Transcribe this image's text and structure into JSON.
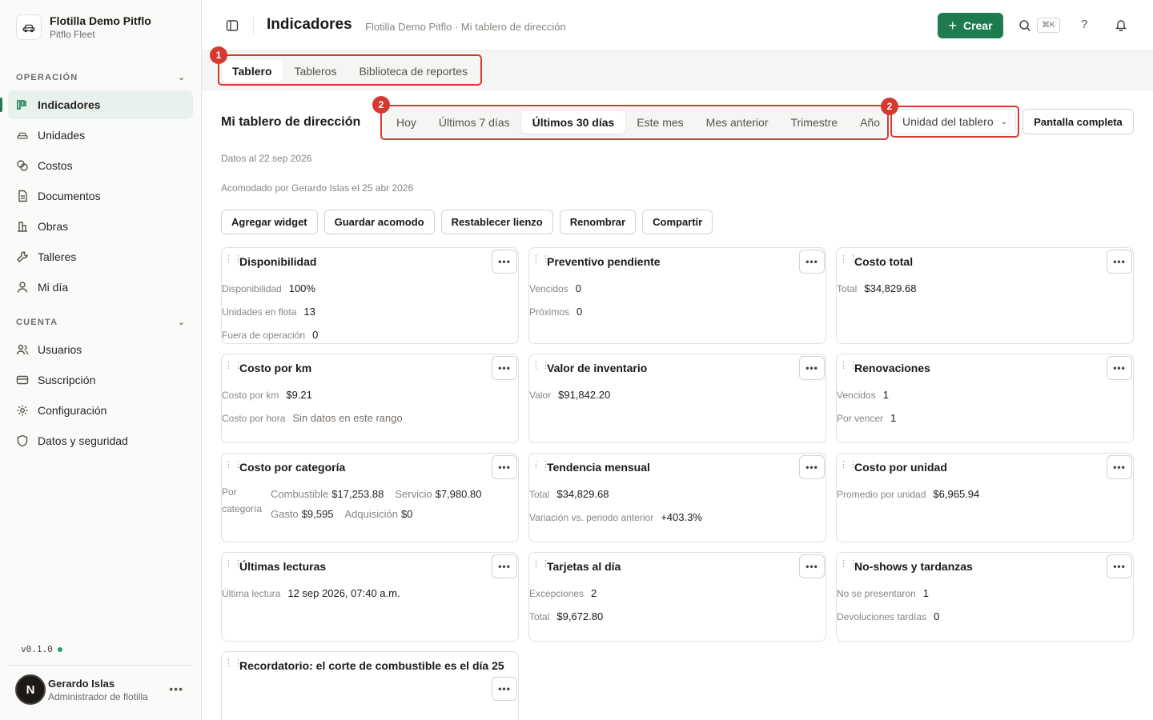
{
  "org": {
    "name": "Flotilla Demo Pitflo",
    "subtitle": "Pitflo Fleet"
  },
  "sidebar": {
    "section_operation": "OPERACIÓN",
    "section_account": "CUENTA",
    "operation_items": [
      {
        "label": "Indicadores",
        "icon": "chart-bars-icon",
        "active": true
      },
      {
        "label": "Unidades",
        "icon": "car-icon"
      },
      {
        "label": "Costos",
        "icon": "coins-icon"
      },
      {
        "label": "Documentos",
        "icon": "document-icon"
      },
      {
        "label": "Obras",
        "icon": "building-icon"
      },
      {
        "label": "Talleres",
        "icon": "wrench-icon"
      },
      {
        "label": "Mi día",
        "icon": "person-icon"
      }
    ],
    "account_items": [
      {
        "label": "Usuarios",
        "icon": "users-icon"
      },
      {
        "label": "Suscripción",
        "icon": "card-icon"
      },
      {
        "label": "Configuración",
        "icon": "gear-icon"
      },
      {
        "label": "Datos y seguridad",
        "icon": "shield-icon"
      }
    ],
    "version": "v0.1.0",
    "user": {
      "initial": "N",
      "name": "Gerardo Islas",
      "role": "Administrador de flotilla"
    }
  },
  "header": {
    "title": "Indicadores",
    "breadcrumb": "Flotilla Demo Pitflo · Mi tablero de dirección",
    "create_label": "Crear",
    "shortcut": "⌘K",
    "help": "?"
  },
  "tabs": [
    "Tablero",
    "Tableros",
    "Biblioteca de reportes"
  ],
  "annotations": {
    "one": "1",
    "two": "2"
  },
  "board": {
    "title": "Mi tablero de dirección",
    "ranges": [
      "Hoy",
      "Últimos 7 días",
      "Últimos 30 días",
      "Este mes",
      "Mes anterior",
      "Trimestre",
      "Año"
    ],
    "active_range": "Últimos 30 días",
    "unit_select": "Unidad del tablero",
    "fullscreen": "Pantalla completa",
    "data_as_of": "Datos al 22 sep 2026",
    "arranged_by": "Acomodado por Gerardo Islas el 25 abr 2026",
    "actions": [
      "Agregar widget",
      "Guardar acomodo",
      "Restablecer lienzo",
      "Renombrar",
      "Compartir"
    ]
  },
  "widgets": {
    "disponibilidad": {
      "title": "Disponibilidad",
      "rows": [
        [
          "Disponibilidad",
          "100%"
        ],
        [
          "Unidades en flota",
          "13"
        ],
        [
          "Fuera de operación",
          "0"
        ]
      ]
    },
    "preventivo": {
      "title": "Preventivo pendiente",
      "rows": [
        [
          "Vencidos",
          "0"
        ],
        [
          "Próximos",
          "0"
        ]
      ]
    },
    "costo_total": {
      "title": "Costo total",
      "rows": [
        [
          "Total",
          "$34,829.68"
        ]
      ]
    },
    "costo_km": {
      "title": "Costo por km",
      "rows": [
        [
          "Costo por km",
          "$9.21"
        ],
        [
          "Costo por hora",
          "Sin datos en este rango"
        ]
      ]
    },
    "inventario": {
      "title": "Valor de inventario",
      "rows": [
        [
          "Valor",
          "$91,842.20"
        ]
      ]
    },
    "renovaciones": {
      "title": "Renovaciones",
      "rows": [
        [
          "Vencidos",
          "1"
        ],
        [
          "Por vencer",
          "1"
        ]
      ]
    },
    "costo_categoria": {
      "title": "Costo por categoría",
      "label_a": "Por",
      "label_b": "categoría",
      "items": [
        [
          "Combustible",
          "$17,253.88"
        ],
        [
          "Servicio",
          "$7,980.80"
        ],
        [
          "Gasto",
          "$9,595"
        ],
        [
          "Adquisición",
          "$0"
        ]
      ]
    },
    "tendencia": {
      "title": "Tendencia mensual",
      "rows": [
        [
          "Total",
          "$34,829.68"
        ],
        [
          "Variación vs. periodo anterior",
          "+403.3%"
        ]
      ]
    },
    "costo_unidad": {
      "title": "Costo por unidad",
      "rows": [
        [
          "Promedio por unidad",
          "$6,965.94"
        ]
      ]
    },
    "lecturas": {
      "title": "Últimas lecturas",
      "rows": [
        [
          "Última lectura",
          "12 sep 2026, 07:40 a.m."
        ]
      ]
    },
    "tarjetas": {
      "title": "Tarjetas al día",
      "rows": [
        [
          "Excepciones",
          "2"
        ],
        [
          "Total",
          "$9,672.80"
        ]
      ]
    },
    "noshows": {
      "title": "No-shows y tardanzas",
      "rows": [
        [
          "No se presentaron",
          "1"
        ],
        [
          "Devoluciones tardías",
          "0"
        ]
      ]
    },
    "recordatorio": {
      "title": "Recordatorio: el corte de combustible es el día 25"
    }
  },
  "colors": {
    "accent": "#1e7b4f",
    "highlight": "#d43a32",
    "active_nav_bg": "#e8f1ec"
  }
}
